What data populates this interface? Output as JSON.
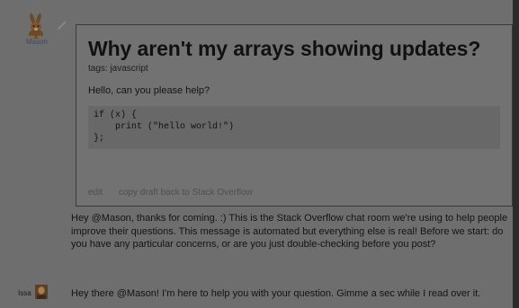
{
  "users": {
    "mason": {
      "name": "Mason"
    },
    "issa": {
      "name": "Issa"
    }
  },
  "icons": {
    "mason_avatar": "rabbit-avatar-icon",
    "edit_pencil": "pencil-icon",
    "issa_avatar": "user-photo-avatar"
  },
  "draft": {
    "title": "Why aren't my arrays showing updates?",
    "tags": "tags: javascript",
    "body": "Hello, can you please help?",
    "code": "if (x) {\n    print (\"hello world!\")\n};",
    "edit_label": "edit",
    "copy_label": "copy draft back to Stack Overflow"
  },
  "messages": [
    {
      "author": "system",
      "text": "Hey @Mason, thanks for coming. :) This is the Stack Overflow chat room we're using to help people improve their questions. This message is automated but everything else is real! Before we start: do you have any particular concerns, or are you just double-checking before you post?"
    },
    {
      "author": "Issa",
      "text": "Hey there @Mason! I'm here to help you with your question. Gimme a sec while I read over it."
    }
  ],
  "colors": {
    "overlay_background": "#6e6e6e",
    "card_border": "#3a3a3a",
    "code_background": "#686868",
    "username_link": "#3a4a66"
  }
}
